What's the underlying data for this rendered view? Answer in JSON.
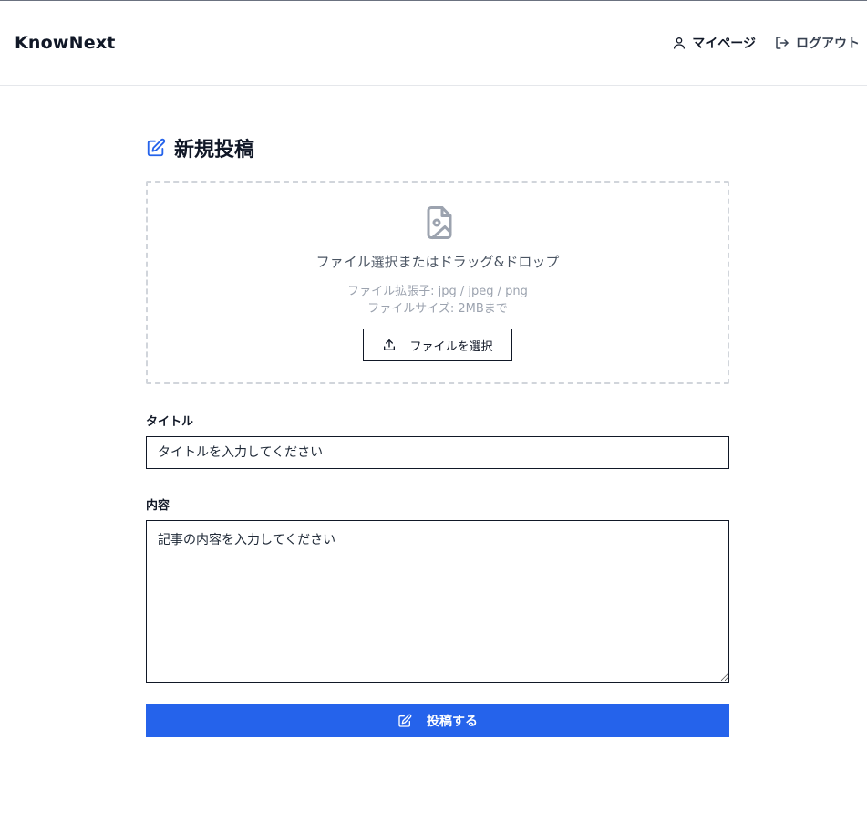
{
  "header": {
    "brand": "KnowNext",
    "nav": {
      "mypage_label": "マイページ",
      "logout_label": "ログアウト"
    }
  },
  "page": {
    "title": "新規投稿"
  },
  "upload": {
    "main_text": "ファイル選択またはドラッグ&ドロップ",
    "extensions_text": "ファイル拡張子: jpg / jpeg / png",
    "size_text": "ファイルサイズ: 2MBまで",
    "button_label": "ファイルを選択",
    "icon": "image-file-icon"
  },
  "form": {
    "title_label": "タイトル",
    "title_placeholder": "タイトルを入力してください",
    "content_label": "内容",
    "content_placeholder": "記事の内容を入力してください",
    "submit_label": "投稿する"
  },
  "colors": {
    "accent": "#2563eb",
    "text": "#111827",
    "muted": "#9ca3af",
    "border": "#d1d5db"
  }
}
